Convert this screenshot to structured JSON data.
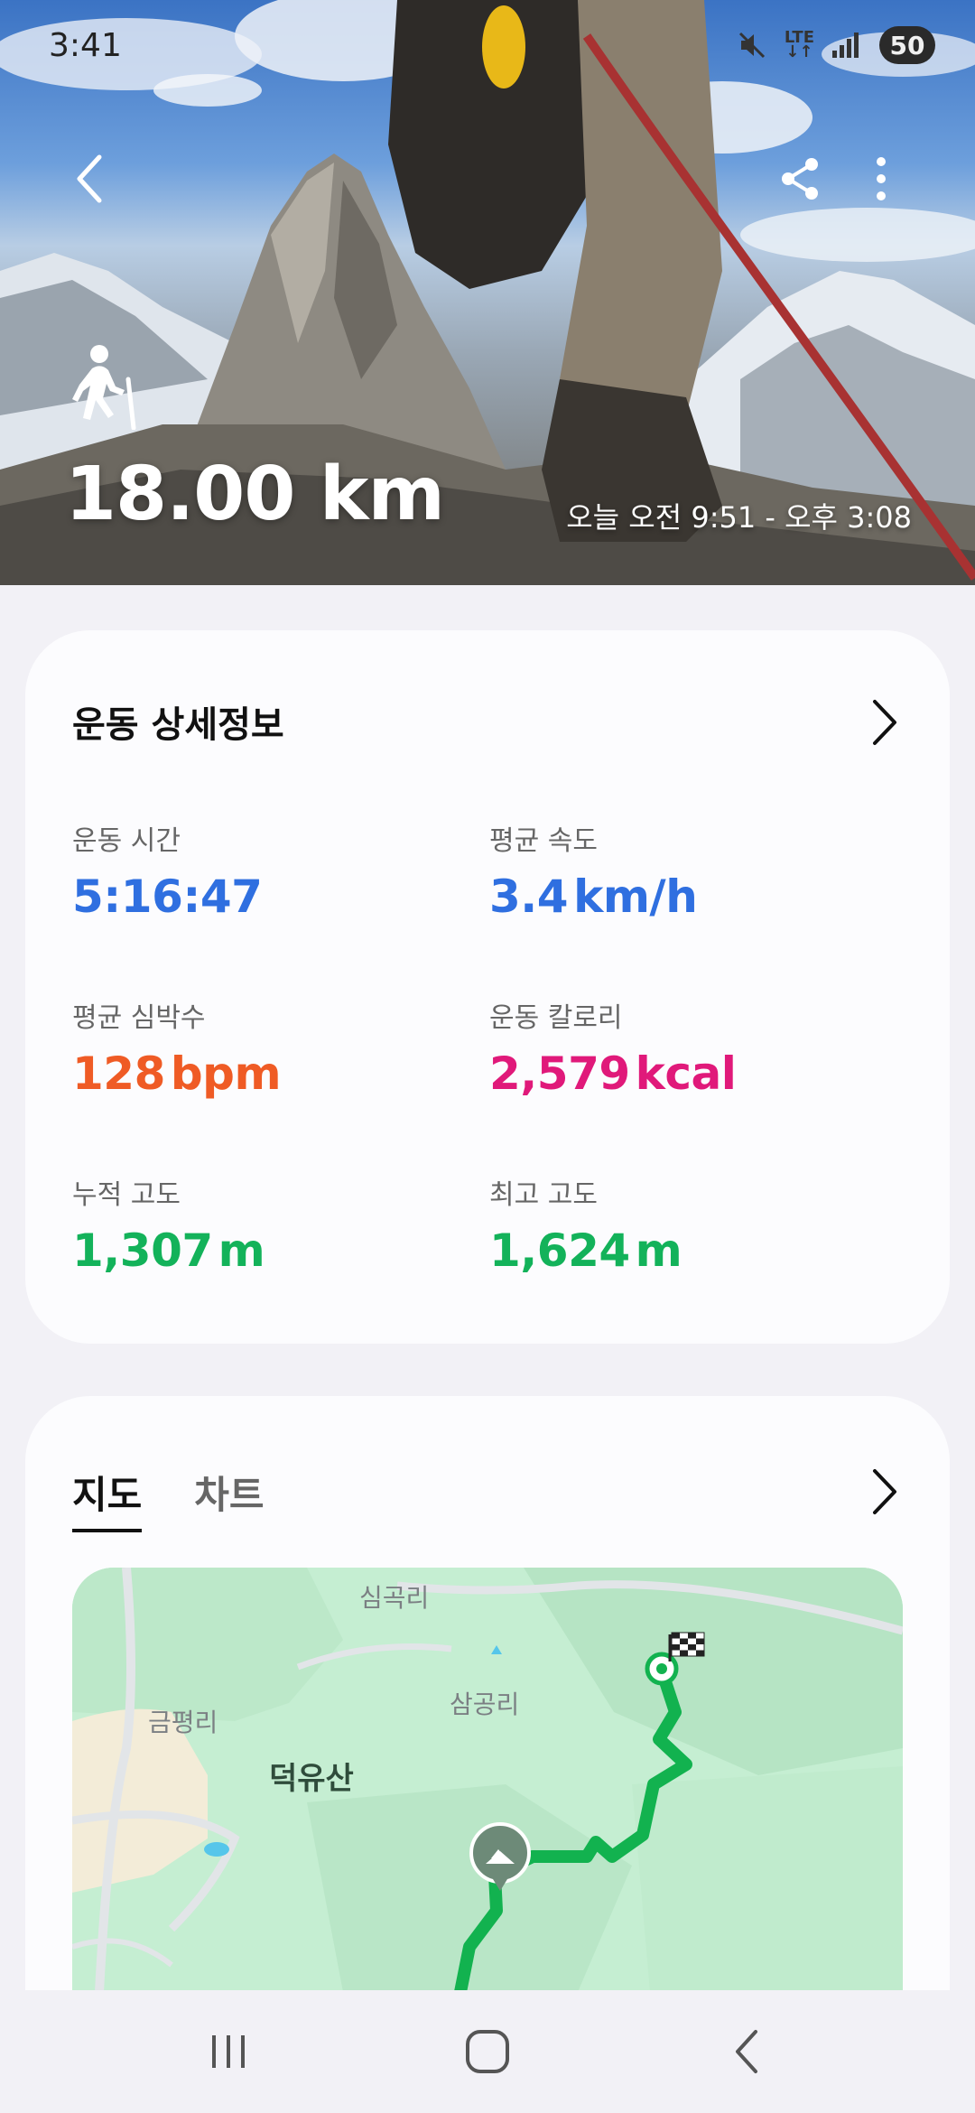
{
  "status_bar": {
    "time": "3:41",
    "network": "LTE",
    "battery": "50",
    "icons": [
      "mute-icon",
      "lte-icon",
      "signal-icon",
      "battery-icon"
    ]
  },
  "hero": {
    "activity_icon": "hiking-icon",
    "distance": "18.00 km",
    "time_range": "오늘 오전 9:51 - 오후 3:08"
  },
  "details": {
    "title": "운동 상세정보",
    "metrics": [
      {
        "label": "운동 시간",
        "value": "5:16:47",
        "unit": "",
        "color": "#2f6fe0"
      },
      {
        "label": "평균 속도",
        "value": "3.4",
        "unit": "km/h",
        "color": "#2f6fe0"
      },
      {
        "label": "평균 심박수",
        "value": "128",
        "unit": "bpm",
        "color": "#ef5b25"
      },
      {
        "label": "운동 칼로리",
        "value": "2,579",
        "unit": "kcal",
        "color": "#e0197a"
      },
      {
        "label": "누적 고도",
        "value": "1,307",
        "unit": "m",
        "color": "#13b25a"
      },
      {
        "label": "최고 고도",
        "value": "1,624",
        "unit": "m",
        "color": "#13b25a"
      }
    ]
  },
  "map_section": {
    "tabs": [
      "지도",
      "차트"
    ],
    "active_tab": "지도",
    "places": [
      "심곡리",
      "삼공리",
      "금평리",
      "덕유산"
    ],
    "route_color": "#12b24f"
  },
  "nav_bar": {
    "buttons": [
      "recent-apps-icon",
      "home-icon",
      "back-nav-icon"
    ]
  }
}
